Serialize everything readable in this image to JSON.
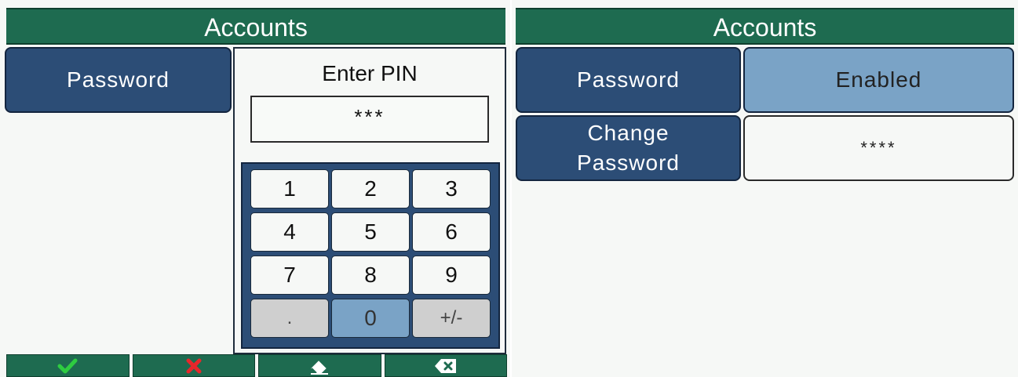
{
  "left_screen": {
    "title": "Accounts",
    "password_label": "Password",
    "pin_dialog": {
      "title": "Enter PIN",
      "entry_value": "***",
      "keys": [
        "1",
        "2",
        "3",
        "4",
        "5",
        "6",
        "7",
        "8",
        "9",
        ".",
        "0",
        "+/-"
      ],
      "selected_key": "0"
    },
    "bottom_bar": [
      {
        "icon": "checkmark-icon",
        "color": "#2ecc40"
      },
      {
        "icon": "cross-icon",
        "color": "#e8262b"
      },
      {
        "icon": "eraser-icon",
        "color": "#ffffff"
      },
      {
        "icon": "backspace-icon",
        "color": "#ffffff"
      }
    ]
  },
  "right_screen": {
    "title": "Accounts",
    "password_label": "Password",
    "password_status": "Enabled",
    "change_password_line1": "Change",
    "change_password_line2": "Password",
    "masked_password": "****"
  },
  "colors": {
    "title_green": "#1e6b50",
    "button_navy": "#2c4d76",
    "highlight_blue": "#7aa3c6",
    "background": "#f6f8f6"
  }
}
